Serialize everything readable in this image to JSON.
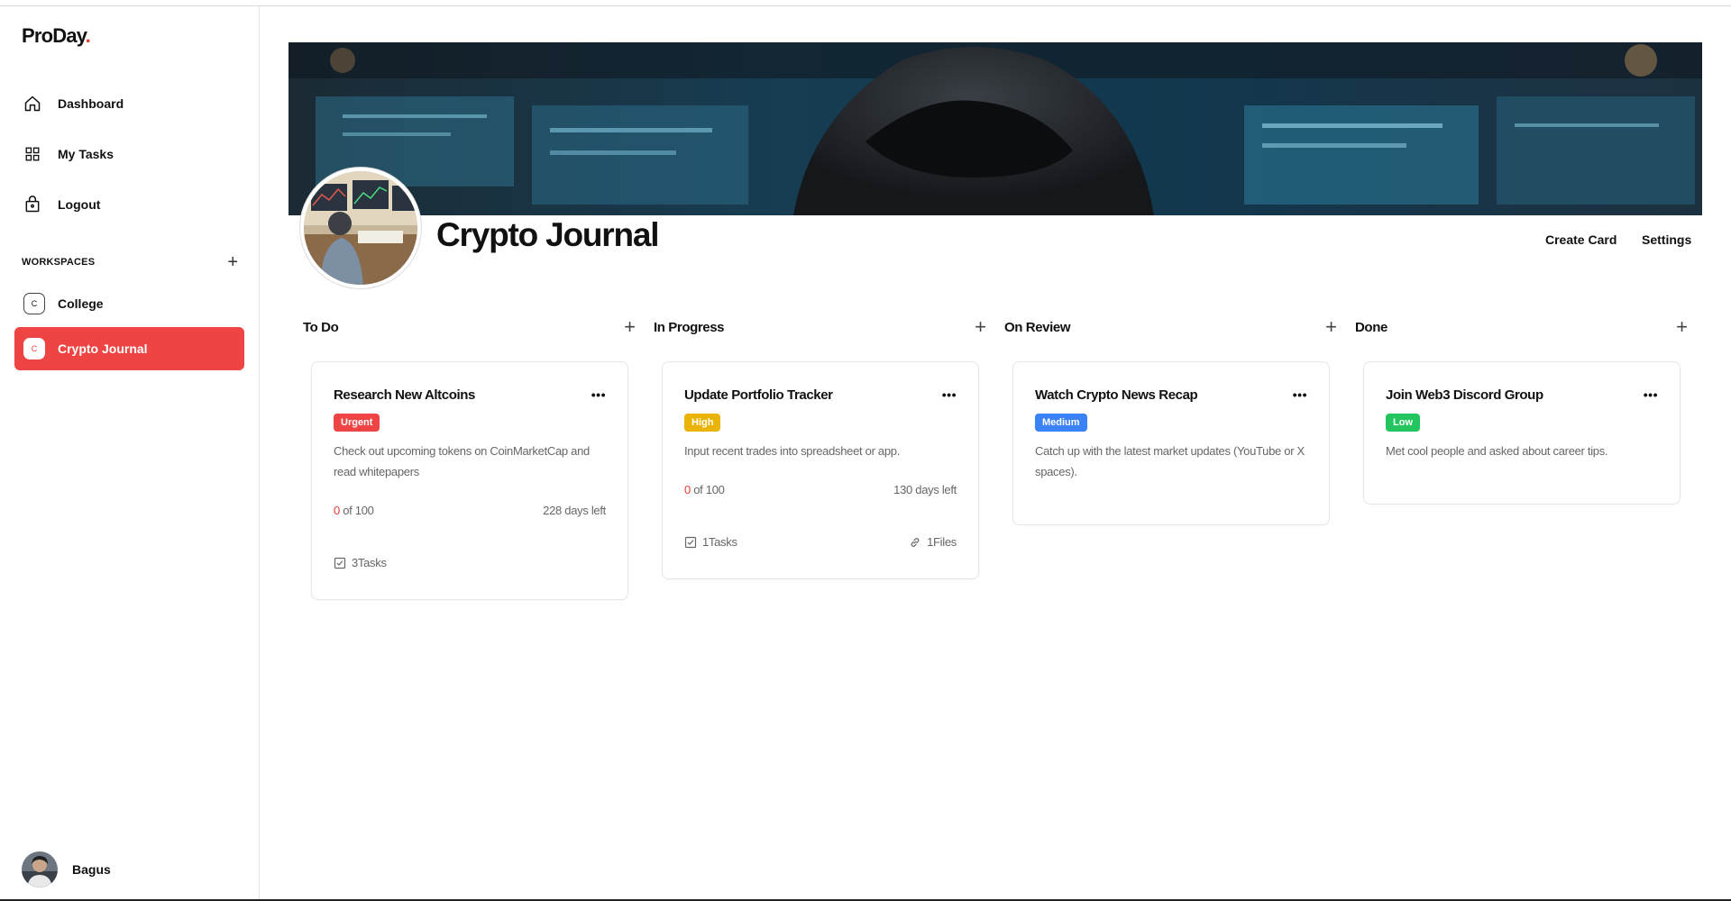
{
  "app": {
    "logo": "ProDay",
    "logo_dot": "."
  },
  "nav": [
    {
      "label": "Dashboard",
      "icon": "home-icon"
    },
    {
      "label": "My Tasks",
      "icon": "grid-icon"
    },
    {
      "label": "Logout",
      "icon": "logout-icon"
    }
  ],
  "workspaces": {
    "title": "WORKSPACES",
    "items": [
      {
        "badge": "C",
        "label": "College",
        "active": false
      },
      {
        "badge": "C",
        "label": "Crypto Journal",
        "active": true
      }
    ]
  },
  "user": {
    "name": "Bagus"
  },
  "board": {
    "title": "Crypto Journal",
    "actions": {
      "create_card": "Create Card",
      "settings": "Settings"
    },
    "columns": [
      {
        "title": "To Do",
        "cards": [
          {
            "title": "Research New Altcoins",
            "priority": "Urgent",
            "priority_color": "#ef4444",
            "description": "Check out upcoming tokens on CoinMarketCap and read whitepapers",
            "progress_done": "0",
            "progress_total": " of 100",
            "days_left": "228 days left",
            "tasks": "3Tasks"
          }
        ]
      },
      {
        "title": "In Progress",
        "cards": [
          {
            "title": "Update Portfolio Tracker",
            "priority": "High",
            "priority_color": "#eab308",
            "description": "Input recent trades into spreadsheet or app.",
            "progress_done": "0",
            "progress_total": " of 100",
            "days_left": "130 days left",
            "tasks": "1Tasks",
            "files": "1Files"
          }
        ]
      },
      {
        "title": "On Review",
        "cards": [
          {
            "title": "Watch Crypto News Recap",
            "priority": "Medium",
            "priority_color": "#3b82f6",
            "description": "Catch up with the latest market updates (YouTube or X spaces)."
          }
        ]
      },
      {
        "title": "Done",
        "cards": [
          {
            "title": "Join Web3 Discord Group",
            "priority": "Low",
            "priority_color": "#22c55e",
            "description": "Met cool people and asked about career tips."
          }
        ]
      }
    ]
  }
}
